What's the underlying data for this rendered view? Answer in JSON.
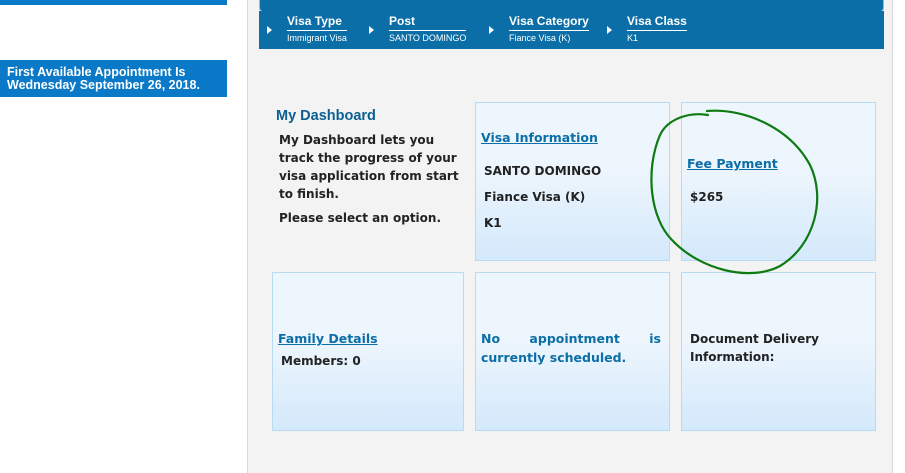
{
  "banner": {
    "appointment_line1": "First Available Appointment Is",
    "appointment_line2": "Wednesday September 26, 2018."
  },
  "breadcrumb": [
    {
      "label": "Visa Type",
      "value": "Immigrant Visa"
    },
    {
      "label": "Post",
      "value": "SANTO DOMINGO"
    },
    {
      "label": "Visa Category",
      "value": "Fiance Visa (K)"
    },
    {
      "label": "Visa Class",
      "value": "K1"
    }
  ],
  "dashboard": {
    "title": "My Dashboard",
    "description": "My Dashboard lets you track the progress of your visa application from start to finish.",
    "prompt": "Please select an option."
  },
  "visa_info": {
    "link": "Visa Information",
    "post": "SANTO DOMINGO",
    "category": "Fiance Visa (K)",
    "class": "K1"
  },
  "fee_payment": {
    "link": "Fee Payment",
    "amount": "$265"
  },
  "family": {
    "link": "Family Details",
    "members": "Members: 0"
  },
  "appointment": {
    "status": "No appointment is currently scheduled."
  },
  "delivery": {
    "label_line1": "Document Delivery",
    "label_line2": "Information:"
  },
  "colors": {
    "accent_blue": "#0a79c7",
    "breadcrumb_blue": "#0b6ea7",
    "annotation_green": "#0d7a12"
  }
}
